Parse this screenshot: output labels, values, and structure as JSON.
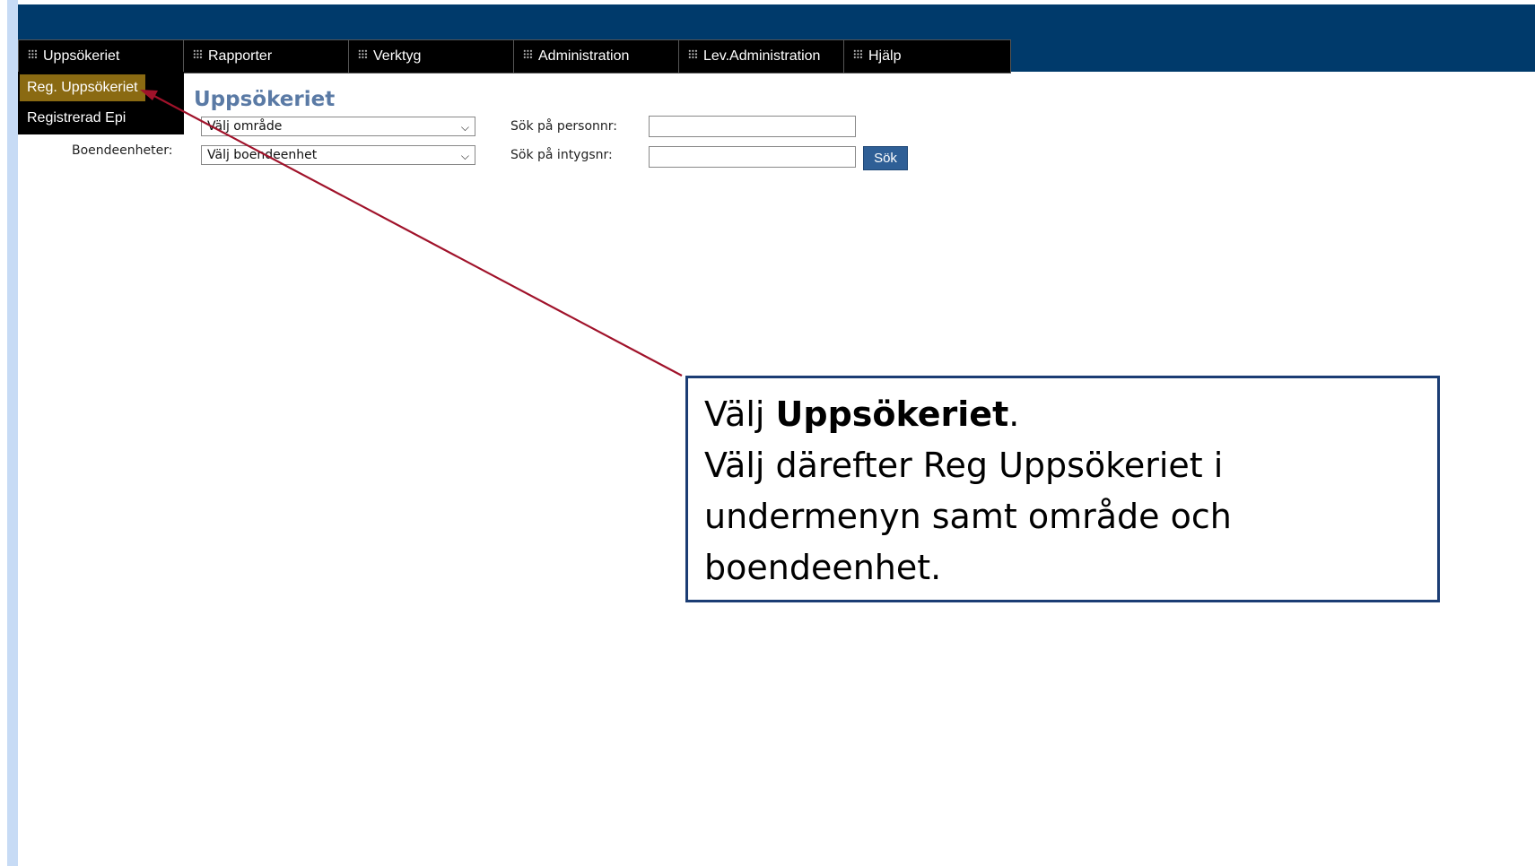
{
  "menu": {
    "items": [
      {
        "label": "Uppsökeriet"
      },
      {
        "label": "Rapporter"
      },
      {
        "label": "Verktyg"
      },
      {
        "label": "Administration"
      },
      {
        "label": "Lev.Administration"
      },
      {
        "label": "Hjälp"
      }
    ]
  },
  "submenu": {
    "items": [
      {
        "label": "Reg. Uppsökeriet",
        "active": true
      },
      {
        "label": "Registrerad Epi"
      }
    ]
  },
  "page": {
    "title": "Uppsökeriet",
    "boendeenheter_label": "Boendeenheter:",
    "area_select_value": "Välj område",
    "unit_select_value": "Välj boendeenhet",
    "search_personnr_label": "Sök på personnr:",
    "search_intygsnr_label": "Sök på intygsnr:",
    "search_personnr_value": "",
    "search_intygsnr_value": "",
    "search_button": "Sök"
  },
  "callout": {
    "line1_prefix": "Välj ",
    "line1_bold": "Uppsökeriet",
    "line1_suffix": ".",
    "line2": "Välj därefter Reg Uppsökeriet i",
    "line3": "undermenyn samt område och",
    "line4": "boendeenhet."
  },
  "colors": {
    "banner": "#003a6b",
    "menu_bg": "#000000",
    "active_item": "#8a6a12",
    "title": "#5a7aa5",
    "button": "#2f5f96",
    "arrow": "#a0122a",
    "callout_border": "#1b3d74"
  }
}
